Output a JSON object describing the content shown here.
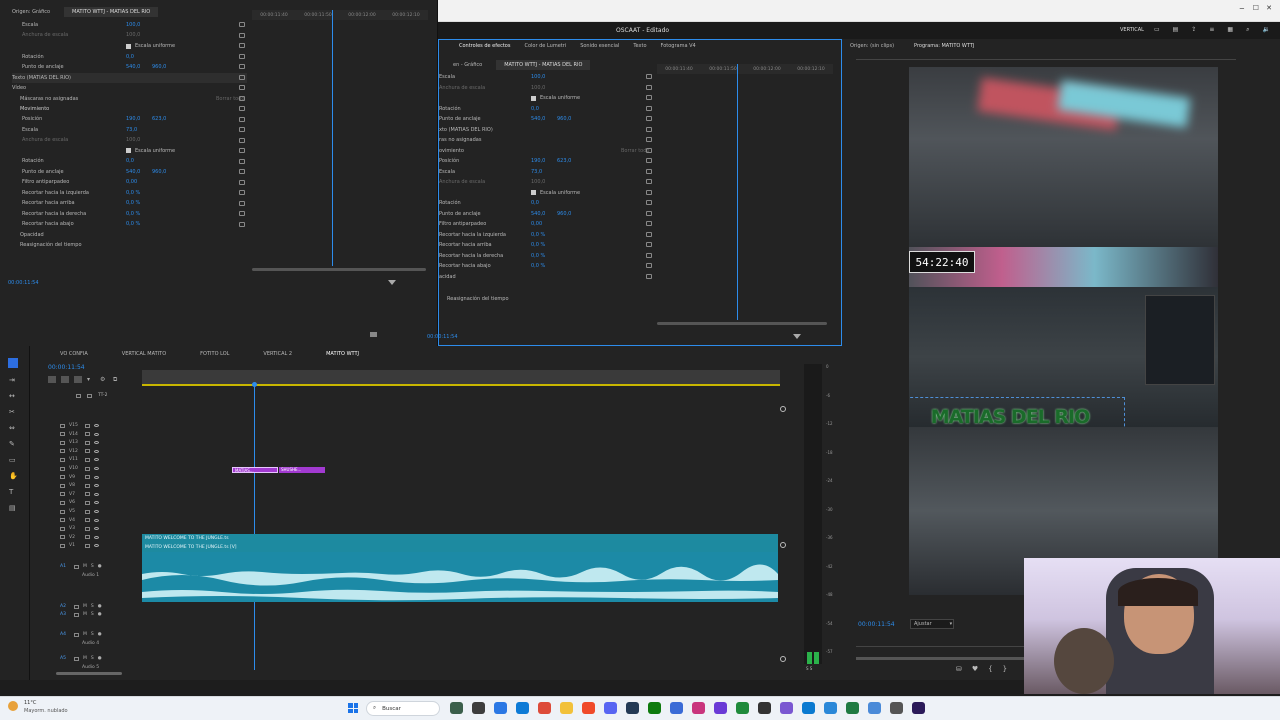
{
  "left_effects": {
    "tabs": [
      "Origen: Gráfico",
      "MATITO WTTJ - MATIAS DEL RIO"
    ],
    "rows": [
      {
        "name": "Escala",
        "value": "100,0"
      },
      {
        "name": "Anchura de escala",
        "value": "100,0"
      },
      {
        "name": "Escala uniforme",
        "value": ""
      },
      {
        "name": "Rotación",
        "value": "0,0"
      },
      {
        "name": "Punto de anclaje",
        "value": "540,0",
        "value2": "960,0"
      },
      {
        "name": "Texto (MATIAS DEL RIO)",
        "value": ""
      }
    ],
    "section_video": "Vídeo",
    "masks": "Máscaras no asignadas",
    "clear_all": "Borrar todo",
    "motion": "Movimiento",
    "motion_rows": [
      {
        "name": "Posición",
        "value": "190,0",
        "value2": "623,0"
      },
      {
        "name": "Escala",
        "value": "73,0"
      },
      {
        "name": "Anchura de escala",
        "value": "100,0"
      },
      {
        "name": "Escala uniforme",
        "value": ""
      },
      {
        "name": "Rotación",
        "value": "0,0"
      },
      {
        "name": "Punto de anclaje",
        "value": "540,0",
        "value2": "960,0"
      },
      {
        "name": "Filtro antiparpadeo",
        "value": "0,00"
      },
      {
        "name": "Recortar hacia la izquierda",
        "value": "0,0 %"
      },
      {
        "name": "Recortar hacia arriba",
        "value": "0,0 %"
      },
      {
        "name": "Recortar hacia la derecha",
        "value": "0,0 %"
      },
      {
        "name": "Recortar hacia abajo",
        "value": "0,0 %"
      }
    ],
    "opacity": "Opacidad",
    "time_remap": "Reasignación del tiempo",
    "ruler": [
      "00:00:11:40",
      "00:00:11:50",
      "00:00:12:00",
      "00:00:12:10"
    ],
    "timecode": "00:00:11:54"
  },
  "window": {
    "title": "OSCAAT - Editado",
    "tabs": [
      "Controles de efectos",
      "Color de Lumetri",
      "Sonido esencial",
      "Texto",
      "Fotograma V4"
    ],
    "sub_tabs": [
      "en - Gráfico",
      "MATITO WTTJ - MATIAS DEL RIO"
    ],
    "rows": [
      {
        "name": "Escala",
        "value": "100,0"
      },
      {
        "name": "Anchura de escala",
        "value": "100,0"
      },
      {
        "name": "Escala uniforme",
        "value": ""
      },
      {
        "name": "Rotación",
        "value": "0,0"
      },
      {
        "name": "Punto de anclaje",
        "value": "540,0",
        "value2": "960,0"
      },
      {
        "name": "xto (MATIAS DEL RIO)",
        "value": ""
      },
      {
        "name": "ras no asignadas",
        "value": ""
      },
      {
        "name": "ovimiento",
        "value": ""
      },
      {
        "name": "Posición",
        "value": "190,0",
        "value2": "623,0"
      },
      {
        "name": "Escala",
        "value": "73,0"
      },
      {
        "name": "Anchura de escala",
        "value": "100,0"
      },
      {
        "name": "Escala uniforme",
        "value": ""
      },
      {
        "name": "Rotación",
        "value": "0,0"
      },
      {
        "name": "Punto de anclaje",
        "value": "540,0",
        "value2": "960,0"
      },
      {
        "name": "Filtro antiparpadeo",
        "value": "0,00"
      },
      {
        "name": "Recortar hacia la izquierda",
        "value": "0,0 %"
      },
      {
        "name": "Recortar hacia arriba",
        "value": "0,0 %"
      },
      {
        "name": "Recortar hacia la derecha",
        "value": "0,0 %"
      },
      {
        "name": "Recortar hacia abajo",
        "value": "0,0 %"
      },
      {
        "name": "acidad",
        "value": ""
      }
    ],
    "clear_all": "Borrar todo",
    "time_remap": "Reasignación del tiempo",
    "ruler": [
      "00:00:11:40",
      "00:00:11:50",
      "00:00:12:00",
      "00:00:12:10"
    ],
    "timecode": "00:00:11:54",
    "vertical_label": "VERTICAL"
  },
  "monitor": {
    "source_tab": "Origen: (sin clips)",
    "program_tab": "Programa: MATITO WTTJ",
    "overlay_timer": "54:22:40",
    "overlay_text": "MATIAS DEL RIO",
    "timecode": "00:00:11:54",
    "fit": "Ajustar"
  },
  "timeline": {
    "tabs": [
      "VO CONFIA",
      "VERTICAL MATITO",
      "FOTITO LOL",
      "VERTICAL 2",
      "MATITO WTTJ"
    ],
    "timecode": "00:00:11:54",
    "top_track": "TT-2",
    "video_tracks": [
      "V15",
      "V14",
      "V13",
      "V12",
      "V11",
      "V10",
      "V9",
      "V8",
      "V7",
      "V6",
      "V5",
      "V4",
      "V3",
      "V2",
      "V1"
    ],
    "audio_tracks": [
      {
        "id": "A1",
        "name": "Audio 1"
      },
      {
        "id": "A2",
        "name": ""
      },
      {
        "id": "A3",
        "name": ""
      },
      {
        "id": "A4",
        "name": "Audio 4"
      },
      {
        "id": "A5",
        "name": "Audio 5"
      }
    ],
    "clips_v10": [
      "MATIAS...",
      "SHUSHE..."
    ],
    "clip_v2": "MATITO WELCOME TO THE JUNGLE.ts",
    "clip_v1": "MATITO WELCOME TO THE JUNGLE.ts [V]",
    "meter_scale": [
      "0",
      "-6",
      "-12",
      "-18",
      "-24",
      "-30",
      "-36",
      "-42",
      "-48",
      "-54",
      "-57"
    ],
    "meter_bottom": "S S"
  },
  "taskbar": {
    "weather_temp": "11°C",
    "weather_desc": "Mayorm. nublado",
    "search": "Buscar"
  },
  "colors": {
    "accent": "#2d8ceb",
    "clip_teal": "#1d8aa0",
    "clip_purple": "#a23ad1"
  }
}
